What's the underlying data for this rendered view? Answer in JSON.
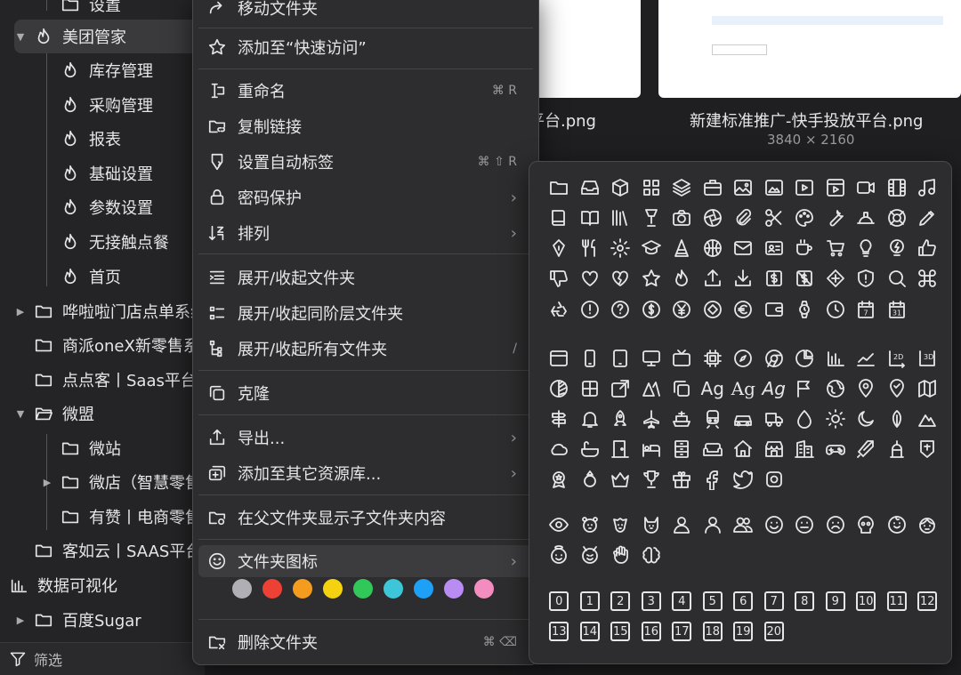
{
  "sidebar": {
    "items": [
      {
        "label": "设置",
        "indent": 1
      },
      {
        "label": "美团管家",
        "indent": 0
      },
      {
        "label": "库存管理",
        "indent": 1
      },
      {
        "label": "采购管理",
        "indent": 1
      },
      {
        "label": "报表",
        "indent": 1
      },
      {
        "label": "基础设置",
        "indent": 1
      },
      {
        "label": "参数设置",
        "indent": 1
      },
      {
        "label": "无接触点餐",
        "indent": 1
      },
      {
        "label": "首页",
        "indent": 1
      },
      {
        "label": "哗啦啦门店点单系统"
      },
      {
        "label": "商派oneX新零售系统"
      },
      {
        "label": "点点客丨Saas平台"
      },
      {
        "label": "微盟"
      },
      {
        "label": "微站"
      },
      {
        "label": "微店（智慧零售）"
      },
      {
        "label": "有赞丨电商零售"
      },
      {
        "label": "客如云丨SAAS平台"
      },
      {
        "label": "数据可视化"
      },
      {
        "label": "百度Sugar"
      }
    ],
    "filter_label": "筛选"
  },
  "thumbs": {
    "left_title": "平台.png",
    "right_title": "新建标准推广-快手投放平台.png",
    "right_size": "3840 × 2160"
  },
  "menu": {
    "move": "移动文件夹",
    "add_quick": "添加至“快速访问”",
    "rename": "重命名",
    "rename_sc": "⌘ R",
    "copy_link": "复制链接",
    "auto_tag": "设置自动标签",
    "auto_tag_sc": "⌘ ⇧ R",
    "password": "密码保护",
    "sort": "排列",
    "expand": "展开/收起文件夹",
    "expand_same": "展开/收起同阶层文件夹",
    "expand_all": "展开/收起所有文件夹",
    "expand_all_sc": "/",
    "clone": "克隆",
    "export": "导出...",
    "add_other": "添加至其它资源库...",
    "show_sub": "在父文件夹显示子文件夹内容",
    "folder_icon": "文件夹图标",
    "delete": "删除文件夹",
    "delete_sc": "⌘ ⌫",
    "chevron": "›"
  },
  "colors": [
    "#b0b0b4",
    "#ee4136",
    "#f39c1e",
    "#f5d20f",
    "#32c759",
    "#3cc6d8",
    "#1ea0f7",
    "#b98cf3",
    "#f48dbf"
  ],
  "icon_panel": {
    "text_icons": [
      "Ag",
      "Ag",
      "Ag"
    ],
    "numbers": [
      "0",
      "1",
      "2",
      "3",
      "4",
      "5",
      "6",
      "7",
      "8",
      "9",
      "10",
      "11",
      "12",
      "13",
      "14",
      "15",
      "16",
      "17",
      "18",
      "19",
      "20"
    ],
    "calendar_numbers": [
      "7",
      "31"
    ],
    "symbols": [
      "$",
      "$",
      "$",
      "¥",
      "€",
      "✚",
      "♻",
      "!",
      "?"
    ]
  }
}
